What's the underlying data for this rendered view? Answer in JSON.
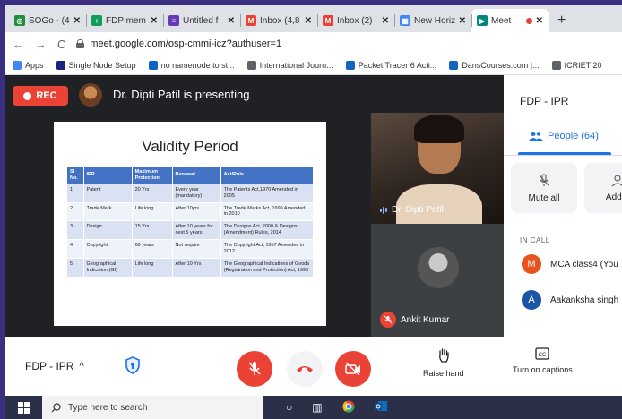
{
  "browser": {
    "tabs": [
      {
        "label": "SOGo - (4",
        "favicon_color": "#1e8e3e",
        "favicon_glyph": "◎",
        "active": false
      },
      {
        "label": "FDP mem",
        "favicon_color": "#0f9d58",
        "favicon_glyph": "+",
        "active": false
      },
      {
        "label": "Untitled f",
        "favicon_color": "#673ab7",
        "favicon_glyph": "≡",
        "active": false
      },
      {
        "label": "Inbox (4,8",
        "favicon_color": "#ea4335",
        "favicon_glyph": "M",
        "active": false
      },
      {
        "label": "Inbox (2)",
        "favicon_color": "#ea4335",
        "favicon_glyph": "M",
        "active": false
      },
      {
        "label": "New Horiz",
        "favicon_color": "#4285f4",
        "favicon_glyph": "▦",
        "active": false
      },
      {
        "label": "Meet",
        "favicon_color": "#00897b",
        "favicon_glyph": "▶",
        "active": true
      }
    ],
    "new_tab": "+",
    "url": "meet.google.com/osp-cmmi-icz?authuser=1",
    "bookmarks": [
      {
        "label": "Apps",
        "color": "#4285f4"
      },
      {
        "label": "Single Node Setup",
        "color": "#1a237e"
      },
      {
        "label": "no namenode to st...",
        "color": "#0a66c2"
      },
      {
        "label": "International Journ...",
        "color": "#5f6368"
      },
      {
        "label": "Packet Tracer 6 Acti...",
        "color": "#1565c0"
      },
      {
        "label": "DansCourses.com |...",
        "color": "#1565c0"
      },
      {
        "label": "ICRIET 20",
        "color": "#5f6368"
      }
    ]
  },
  "meet": {
    "rec_label": "REC",
    "presenting_text": "Dr. Dipti Patil is presenting",
    "slide": {
      "title": "Validity Period",
      "headers": [
        "Sl No.",
        "IPR",
        "Maximum Protection",
        "Renewal",
        "Act/Rule"
      ],
      "rows": [
        [
          "1",
          "Patent",
          "20 Yrs",
          "Every year (mandatory)",
          "The Patents Act,1970 Amended in 2005"
        ],
        [
          "2",
          "Trade Mark",
          "Life long",
          "After 10yrs",
          "The Trade Marks Act, 1999 Amended in 2010"
        ],
        [
          "3",
          "Design",
          "15 Yrs",
          "After 10 years for next 5 years",
          "The Designs Act, 2000 & Designs (Amendment) Rules, 2014"
        ],
        [
          "4",
          "Copyright",
          "60 years",
          "Not require",
          "The Copyright Act, 1957 Amended in 2012"
        ],
        [
          "5",
          "Geographical Indication (GI)",
          "Life long",
          "After 10 Yrs",
          "The Geographical Indications of Goods (Registration and Protection) Act, 1999"
        ]
      ]
    },
    "tiles": [
      {
        "name": "Dr. Dipti Patil"
      },
      {
        "name": "Ankit Kumar"
      }
    ]
  },
  "panel": {
    "title": "FDP - IPR",
    "people_tab": "People (64)",
    "actions": [
      "Mute all",
      "Add p"
    ],
    "section_label": "IN CALL",
    "people": [
      {
        "initial": "M",
        "name": "MCA class4 (You",
        "color": "#e8541e"
      },
      {
        "initial": "A",
        "name": "Aakanksha singh",
        "color": "#1a56a8"
      }
    ]
  },
  "controls": {
    "meeting_name": "FDP - IPR",
    "raise_hand": "Raise hand",
    "captions": "Turn on captions",
    "colors": {
      "danger": "#ea4335"
    }
  },
  "taskbar": {
    "search_placeholder": "Type here to search"
  }
}
